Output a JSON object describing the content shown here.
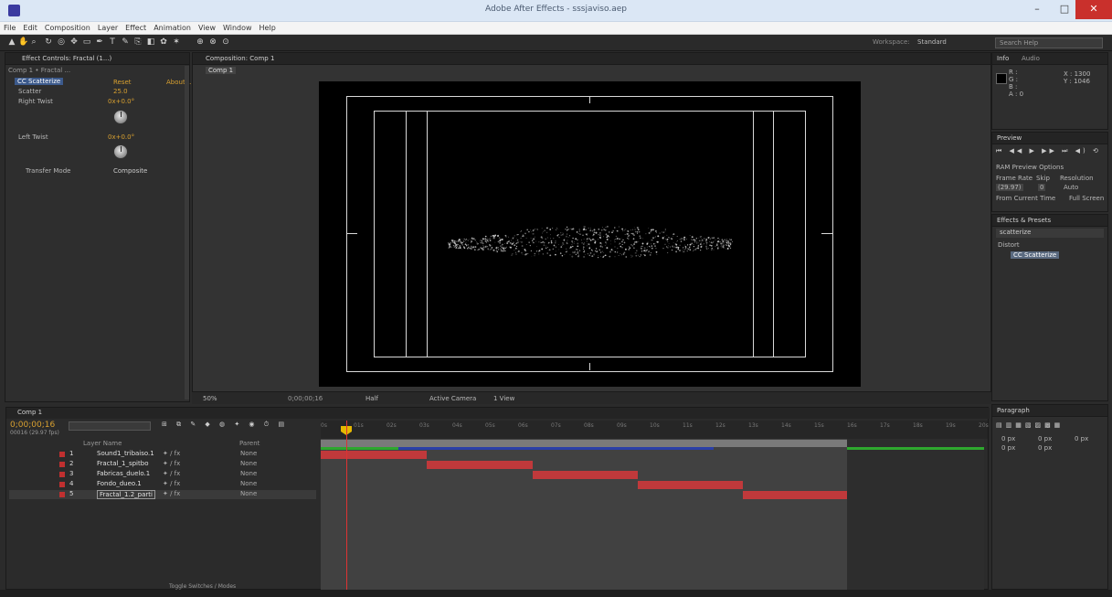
{
  "window": {
    "title": "Adobe After Effects - sssjaviso.aep",
    "minimize": "–",
    "maximize": "□",
    "close": "✕"
  },
  "menu": [
    "File",
    "Edit",
    "Composition",
    "Layer",
    "Effect",
    "Animation",
    "View",
    "Window",
    "Help"
  ],
  "toolbar": {
    "workspace_label": "Workspace:",
    "workspace_value": "Standard",
    "search_placeholder": "Search Help"
  },
  "effect_controls": {
    "tab": "Effect Controls: Fractal (1...)",
    "breadcrumb": "Comp 1 • Fractal ...",
    "effect_name": "CC Scatterize",
    "reset_label": "Reset",
    "about_label": "About...",
    "scatter_label": "Scatter",
    "scatter_value": "25.0",
    "right_twist_label": "Right Twist",
    "right_twist_value": "0x+0.0°",
    "left_twist_label": "Left Twist",
    "left_twist_value": "0x+0.0°",
    "transfer_mode_label": "Transfer Mode",
    "transfer_mode_value": "Composite"
  },
  "composition": {
    "tab": "Composition: Comp 1",
    "subtab": "Comp 1",
    "zoom": "50%",
    "quality": "Half",
    "view": "Active Camera",
    "views": "1 View",
    "timecode_bar": "0;00;00;16"
  },
  "info": {
    "tab": "Info",
    "audio_tab": "Audio",
    "r": "R :",
    "g": "G :",
    "b": "B :",
    "a": "A : 0",
    "x": "X : 1300",
    "y": "Y : 1046"
  },
  "preview": {
    "tab": "Preview",
    "ram_options": "RAM Preview Options",
    "frame_rate_label": "Frame Rate",
    "skip_label": "Skip",
    "resolution_label": "Resolution",
    "frame_rate_value": "(29.97)",
    "skip_value": "0",
    "resolution_value": "Auto",
    "from_current": "From Current Time",
    "full_screen": "Full Screen"
  },
  "effects_presets": {
    "tab": "Effects & Presets",
    "search_value": "scatterize",
    "category": "Distort",
    "item": "CC Scatterize"
  },
  "paragraph": {
    "tab": "Paragraph",
    "v1": "0 px",
    "v2": "0 px",
    "v3": "0 px",
    "v4": "0 px",
    "v5": "0 px"
  },
  "timeline": {
    "tab": "Comp 1",
    "timecode": "0;00;00;16",
    "fps_label": "00016 (29.97 fps)",
    "col_layer_name": "Layer Name",
    "col_parent": "Parent",
    "layers": [
      {
        "num": "1",
        "name": "Sound1_tribaiso.1",
        "parent": "None"
      },
      {
        "num": "2",
        "name": "Fractal_1_spitbo",
        "parent": "None"
      },
      {
        "num": "3",
        "name": "Fabricas_duelo.1",
        "parent": "None"
      },
      {
        "num": "4",
        "name": "Fondo_dueo.1",
        "parent": "None"
      },
      {
        "num": "5",
        "name": "Fractal_1.2_parti",
        "parent": "None"
      }
    ],
    "ruler_ticks": [
      "0s",
      "01s",
      "02s",
      "03s",
      "04s",
      "05s",
      "06s",
      "07s",
      "08s",
      "09s",
      "10s",
      "11s",
      "12s",
      "13s",
      "14s",
      "15s",
      "16s",
      "17s",
      "18s",
      "19s",
      "20s"
    ],
    "toggle_label": "Toggle Switches / Modes"
  },
  "colors": {
    "accent": "#d8a030",
    "bar_red": "#c0393b",
    "bar_blue": "#2a3fa8",
    "bar_green": "#2ea82e"
  }
}
